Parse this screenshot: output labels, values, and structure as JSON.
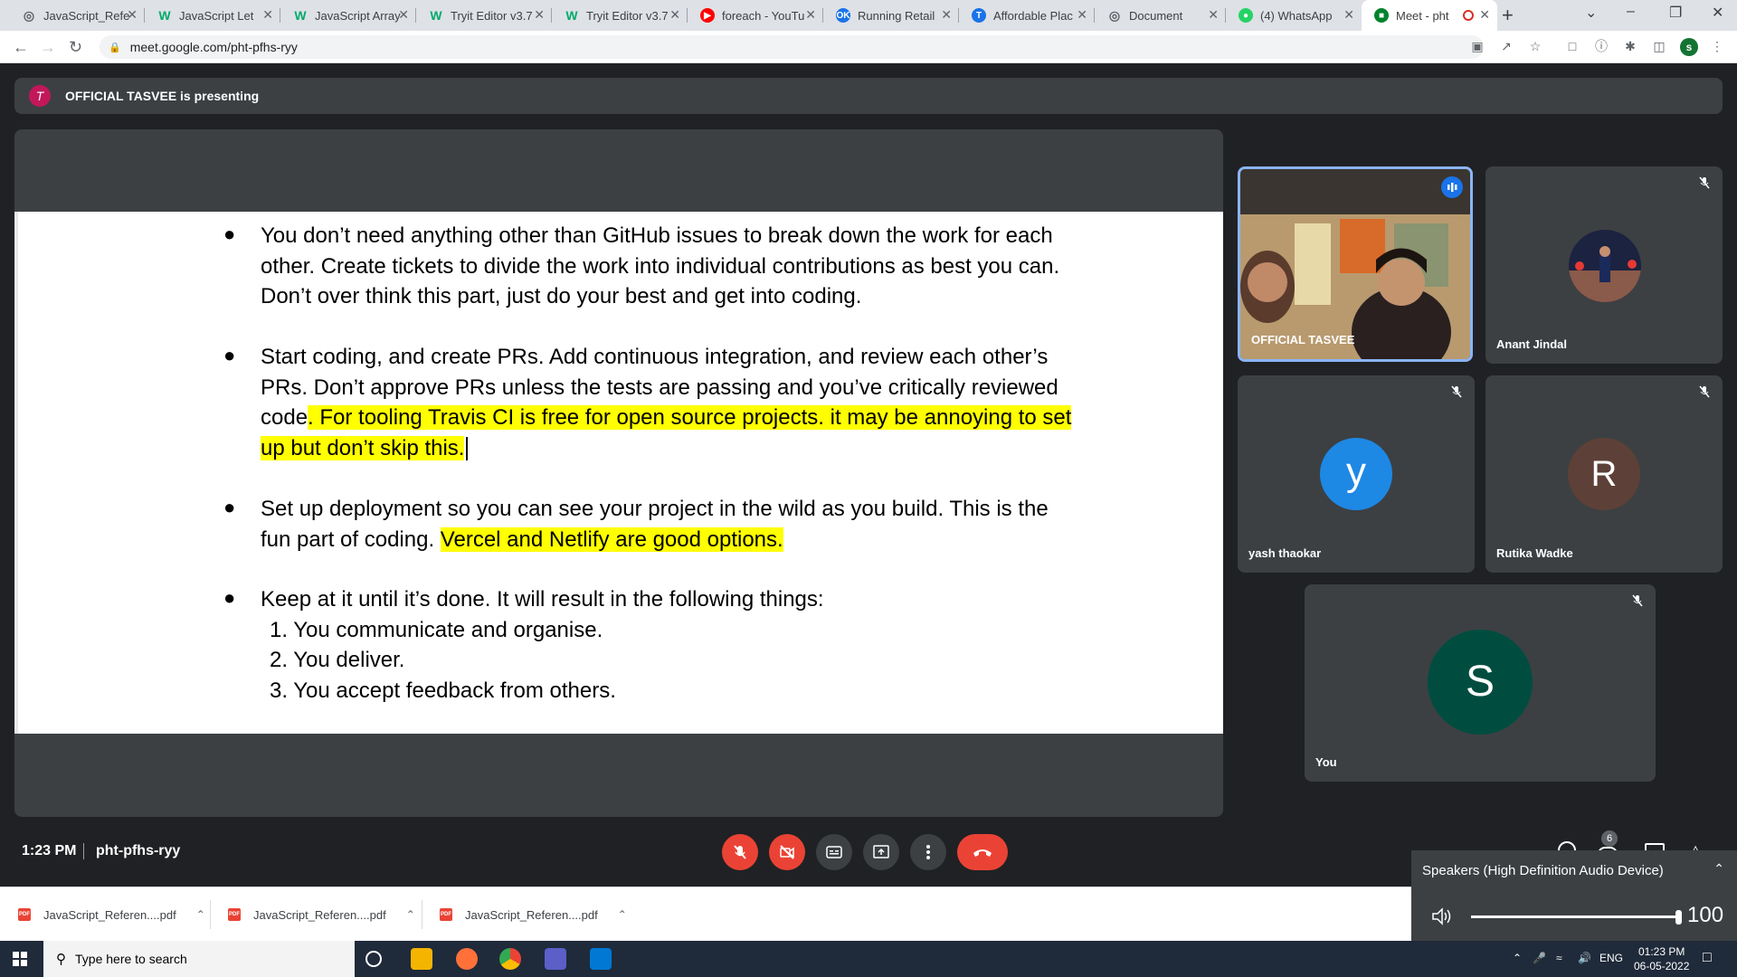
{
  "browser": {
    "tabs": [
      {
        "title": "JavaScript_Refe",
        "favicon": "globe",
        "color": "#5f6368"
      },
      {
        "title": "JavaScript Let",
        "favicon": "w3",
        "color": "#04aa6d"
      },
      {
        "title": "JavaScript Array",
        "favicon": "w3",
        "color": "#04aa6d"
      },
      {
        "title": "Tryit Editor v3.7",
        "favicon": "w3",
        "color": "#04aa6d"
      },
      {
        "title": "Tryit Editor v3.7",
        "favicon": "w3",
        "color": "#04aa6d"
      },
      {
        "title": "foreach - YouTu",
        "favicon": "youtube",
        "color": "#ff0000"
      },
      {
        "title": "Running Retail",
        "favicon": "ok",
        "color": "#1a73e8"
      },
      {
        "title": "Affordable Plac",
        "favicon": "tata",
        "color": "#1a73e8"
      },
      {
        "title": "Document",
        "favicon": "globe",
        "color": "#5f6368"
      },
      {
        "title": "(4) WhatsApp",
        "favicon": "whatsapp",
        "color": "#25d366"
      },
      {
        "title": "Meet - pht",
        "favicon": "meet",
        "color": "#00832d"
      }
    ],
    "url": "meet.google.com/pht-pfhs-ryy",
    "profile_initial": "s"
  },
  "meet": {
    "presenting_banner": "OFFICIAL TASVEE is presenting",
    "slide": {
      "bullets": [
        {
          "lines": [
            [
              {
                "t": "You don’t need anything other than GitHub issues to break down the work for each",
                "h": false
              }
            ],
            [
              {
                "t": "other. Create tickets to divide the work into individual contributions as best you can.",
                "h": false
              }
            ],
            [
              {
                "t": "Don’t over think this part, just do your best and get into coding.",
                "h": false
              }
            ]
          ]
        },
        {
          "lines": [
            [
              {
                "t": "Start coding, and create PRs. Add continuous integration, and review each other’s",
                "h": false
              }
            ],
            [
              {
                "t": "PRs. Don’t approve PRs unless the tests are passing and you’ve critically reviewed",
                "h": false
              }
            ],
            [
              {
                "t": "code",
                "h": false
              },
              {
                "t": ". For tooling Travis CI is free for open source projects. it may be annoying to set",
                "h": true
              }
            ],
            [
              {
                "t": "up but don’t skip this.",
                "h": true
              }
            ]
          ]
        },
        {
          "lines": [
            [
              {
                "t": "Set up deployment so you can see your project in the wild as you build. This is the",
                "h": false
              }
            ],
            [
              {
                "t": "fun part of coding. ",
                "h": false
              },
              {
                "t": "Vercel and Netlify are good options.",
                "h": true
              }
            ]
          ]
        },
        {
          "lines": [
            [
              {
                "t": "Keep at it until it’s done. It will result in the following things:",
                "h": false
              }
            ]
          ]
        }
      ],
      "numbered": [
        "1. You communicate and organise.",
        "2. You deliver.",
        "3. You accept feedback from others."
      ]
    },
    "participants": [
      {
        "name": "OFFICIAL TASVEE",
        "speaking": true
      },
      {
        "name": "Anant Jindal",
        "muted": true
      },
      {
        "name": "yash thaokar",
        "initial": "y",
        "color": "#1e88e5",
        "muted": true
      },
      {
        "name": "Rutika Wadke",
        "initial": "R",
        "color": "#5d4037",
        "muted": true
      },
      {
        "name": "You",
        "initial": "S",
        "color": "#004d40",
        "muted": true
      }
    ],
    "clock": "1:23 PM",
    "meeting_code": "pht-pfhs-ryy",
    "people_count": "6"
  },
  "speaker_popup": {
    "device": "Speakers (High Definition Audio Device)",
    "volume": "100",
    "volume_level": 1.0
  },
  "downloads": [
    {
      "name": "JavaScript_Referen....pdf"
    },
    {
      "name": "JavaScript_Referen....pdf"
    },
    {
      "name": "JavaScript_Referen....pdf"
    }
  ],
  "taskbar": {
    "search_placeholder": "Type here to search",
    "lang": "ENG",
    "time": "01:23 PM",
    "date": "06-05-2022"
  }
}
